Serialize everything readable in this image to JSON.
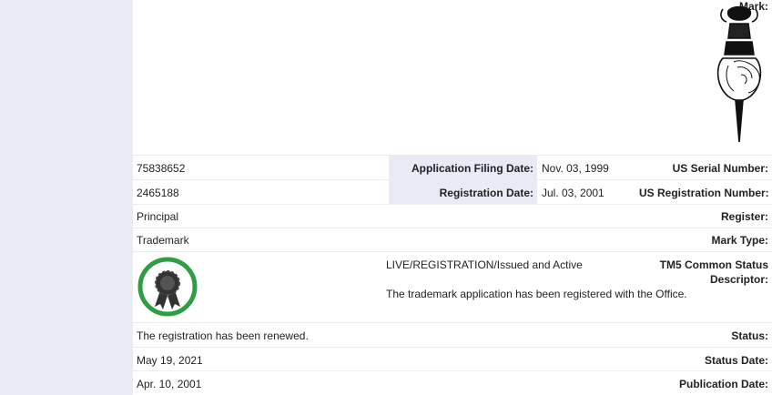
{
  "labels": {
    "mark": "Mark:",
    "serial": "US Serial Number:",
    "registration_number": "US Registration Number:",
    "register": "Register:",
    "mark_type": "Mark Type:",
    "tm5_line1": "TM5 Common Status",
    "tm5_line2": "Descriptor:",
    "status": "Status:",
    "status_date": "Status Date:",
    "publication_date": "Publication Date:",
    "filing_date": "Application Filing Date:",
    "registration_date": "Registration Date:"
  },
  "values": {
    "serial": "75838652",
    "registration_number": "2465188",
    "register": "Principal",
    "mark_type": "Trademark",
    "tm5_status": "LIVE/REGISTRATION/Issued and Active",
    "tm5_description": "The trademark application has been registered with the Office.",
    "status": "The registration has been renewed.",
    "status_date": "May 19, 2021",
    "publication_date": "Apr. 10, 2001",
    "filing_date": "Nov. 03, 1999",
    "registration_date": "Jul. 03, 2001"
  },
  "colors": {
    "label_bg": "#e8eaf6",
    "badge_ring": "#2e9e44",
    "badge_icon": "#333333"
  },
  "icons": {
    "mark_image": "totem-figure-mark-image",
    "status_badge": "award-ribbon-icon"
  }
}
